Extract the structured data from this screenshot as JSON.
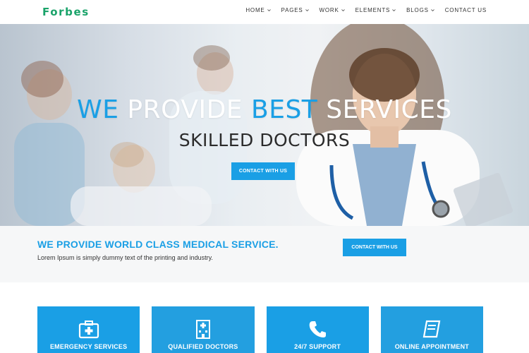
{
  "brand": {
    "name": "Forbes",
    "color": "#1aa36a"
  },
  "nav": {
    "items": [
      {
        "label": "HOME",
        "has_caret": true
      },
      {
        "label": "PAGES",
        "has_caret": true
      },
      {
        "label": "WORK",
        "has_caret": true
      },
      {
        "label": "ELEMENTS",
        "has_caret": true
      },
      {
        "label": "BLOGS",
        "has_caret": true
      },
      {
        "label": "CONTACT US",
        "has_caret": false
      }
    ]
  },
  "hero": {
    "title_part1": "WE",
    "title_part2": " PROVIDE ",
    "title_part3": "BEST",
    "title_part4": " SERVICES",
    "subtitle": "SKILLED DOCTORS",
    "button_label": "CONTACT WITH US"
  },
  "strip": {
    "title": "WE PROVIDE WORLD CLASS MEDICAL SERVICE.",
    "text": "Lorem Ipsum is simply dummy text of the printing and industry.",
    "button_label": "CONTACT WITH US"
  },
  "services": [
    {
      "label": "EMERGENCY SERVICES",
      "icon": "first-aid-kit-icon"
    },
    {
      "label": "QUALIFIED DOCTORS",
      "icon": "hospital-icon"
    },
    {
      "label": "24/7 SUPPORT",
      "icon": "phone-icon"
    },
    {
      "label": "ONLINE APPOINTMENT",
      "icon": "book-icon"
    }
  ],
  "colors": {
    "accent": "#1a9fe5",
    "title_text": "#ffffff",
    "subtitle_text": "#2b2b2b"
  }
}
